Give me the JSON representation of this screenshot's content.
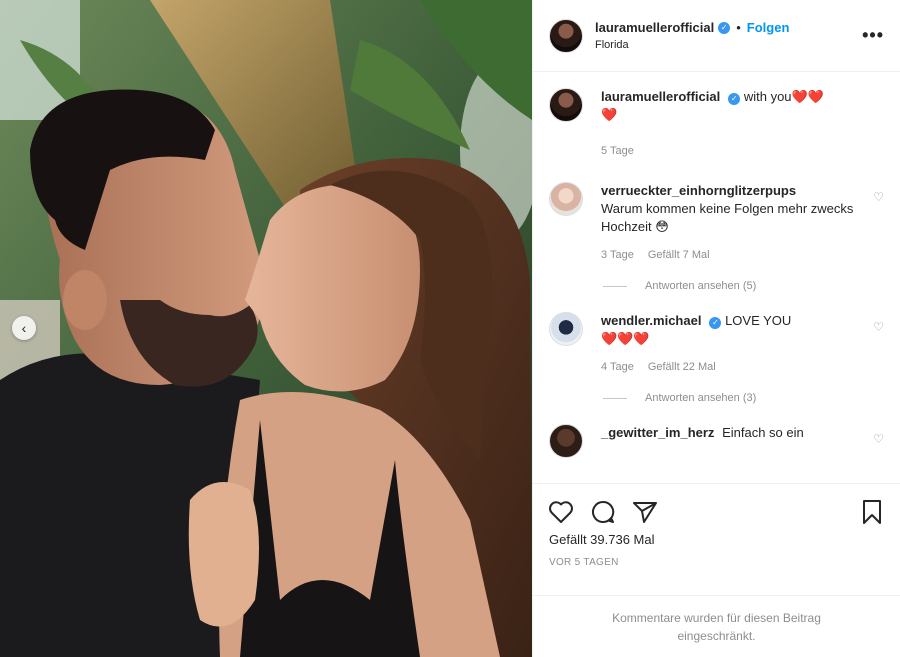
{
  "header": {
    "username": "lauramuellerofficial",
    "follow_label": "Folgen",
    "dot": "•",
    "location": "Florida",
    "more_label": "•••"
  },
  "caption": {
    "username": "lauramuellerofficial",
    "text": "with you",
    "hearts_inline": "❤️❤️",
    "hearts_line2": "❤️",
    "age": "5 Tage"
  },
  "comments": [
    {
      "username": "verrueckter_einhornglitzerpups",
      "text": "Warum kommen keine Folgen mehr zwecks Hochzeit 😳",
      "age": "3 Tage",
      "likes": "Gefällt 7 Mal",
      "replies_label": "Antworten ansehen (5)"
    },
    {
      "username": "wendler.michael",
      "text": "LOVE YOU",
      "hearts": "❤️❤️❤️",
      "age": "4 Tage",
      "likes": "Gefällt 22 Mal",
      "replies_label": "Antworten ansehen (3)"
    },
    {
      "username": "_gewitter_im_herz",
      "text": "Einfach so ein"
    }
  ],
  "likes": {
    "label": "Gefällt 39.736 Mal"
  },
  "post_date": "VOR 5 TAGEN",
  "comments_restricted": "Kommentare wurden für diesen Beitrag eingeschränkt.",
  "icons": {
    "prev": "‹",
    "verified": "✓",
    "heart_small": "♡"
  },
  "colors": {
    "accent": "#0095f6",
    "verified": "#3897f0",
    "heart_red": "#ed4956",
    "muted": "#8e8e8e"
  }
}
